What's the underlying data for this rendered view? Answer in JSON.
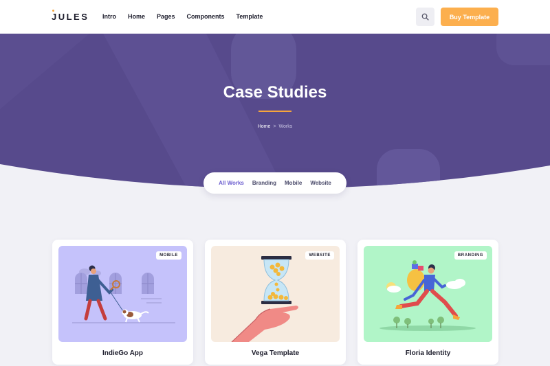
{
  "brand": {
    "logo_text": "JULES",
    "accent": "#f6a53b",
    "hero_color": "#574a8c",
    "primary": "#6c5ecf"
  },
  "nav": {
    "items": [
      {
        "label": "Intro"
      },
      {
        "label": "Home"
      },
      {
        "label": "Pages"
      },
      {
        "label": "Components"
      },
      {
        "label": "Template"
      }
    ]
  },
  "header_actions": {
    "search_icon": "search-icon",
    "buy_label": "Buy Template"
  },
  "hero": {
    "title": "Case Studies",
    "breadcrumb": {
      "home": "Home",
      "separator": ">",
      "current": "Works"
    }
  },
  "filters": {
    "items": [
      {
        "label": "All Works",
        "active": true
      },
      {
        "label": "Branding"
      },
      {
        "label": "Mobile"
      },
      {
        "label": "Website"
      }
    ]
  },
  "cards": [
    {
      "title": "IndieGo App",
      "badge": "MOBILE",
      "bg": "#c5c2fb"
    },
    {
      "title": "Vega Template",
      "badge": "WEBSITE",
      "bg": "#f7ebdf"
    },
    {
      "title": "Floria Identity",
      "badge": "BRANDING",
      "bg": "#b1f5c8"
    }
  ]
}
